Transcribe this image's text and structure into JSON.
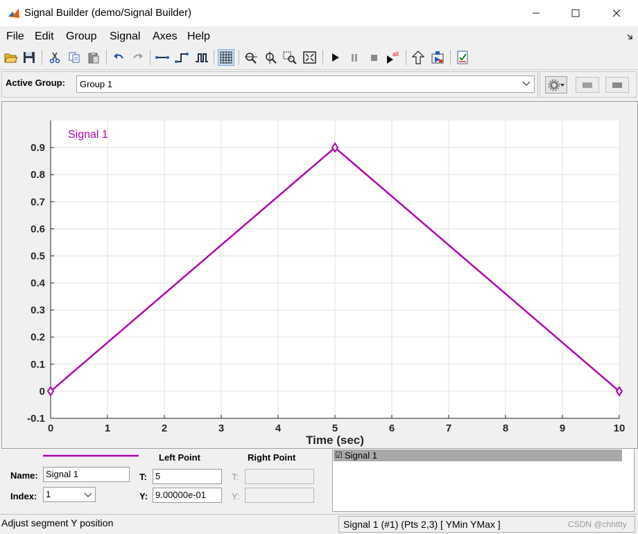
{
  "window": {
    "title": "Signal Builder (demo/Signal Builder)"
  },
  "menu": [
    "File",
    "Edit",
    "Group",
    "Signal",
    "Axes",
    "Help"
  ],
  "group_bar": {
    "label": "Active Group:",
    "selected": "Group 1"
  },
  "chart_data": {
    "type": "line",
    "series": [
      {
        "name": "Signal 1",
        "x": [
          0,
          5,
          10
        ],
        "y": [
          0,
          0.9,
          0
        ],
        "color": "#b000b0"
      }
    ],
    "xlabel": "Time (sec)",
    "ylabel": "",
    "xlim": [
      0,
      10
    ],
    "ylim": [
      -0.1,
      1.0
    ],
    "xticks": [
      0,
      1,
      2,
      3,
      4,
      5,
      6,
      7,
      8,
      9,
      10
    ],
    "xtick_labels": [
      "0",
      "1",
      "2",
      "3",
      "4",
      "5",
      "6",
      "7",
      "8",
      "9",
      "10"
    ],
    "yticks": [
      -0.1,
      0,
      0.1,
      0.2,
      0.3,
      0.4,
      0.5,
      0.6,
      0.7,
      0.8,
      0.9
    ],
    "ytick_labels": [
      "-0.1",
      "0",
      "0.1",
      "0.2",
      "0.3",
      "0.4",
      "0.5",
      "0.6",
      "0.7",
      "0.8",
      "0.9"
    ],
    "grid": true,
    "series_label": "Signal 1"
  },
  "props": {
    "left_point_header": "Left Point",
    "right_point_header": "Right Point",
    "name_label": "Name:",
    "name_value": "Signal 1",
    "index_label": "Index:",
    "index_value": "1",
    "left_t_label": "T:",
    "left_t_value": "5",
    "left_y_label": "Y:",
    "left_y_value": "9.00000e-01",
    "right_t_label": "T:",
    "right_y_label": "Y:",
    "signal_list": [
      "Signal 1"
    ],
    "signal_check": "☑"
  },
  "status": {
    "left": "Adjust segment Y position",
    "right": "Signal 1 (#1) (Pts 2,3)  [ YMin YMax ]",
    "watermark": "CSDN @chhttty"
  },
  "colors": {
    "signal": "#b000b0",
    "grid": "#e0e0e0",
    "background": "#f0f0f0"
  }
}
